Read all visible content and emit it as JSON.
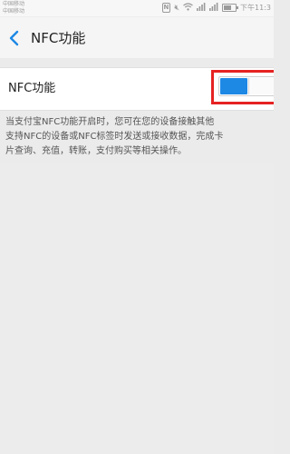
{
  "status_bar": {
    "carrier_1": "中国移动",
    "carrier_2": "中国移动",
    "nfc_indicator": "N",
    "time": "下午11:3",
    "icons": [
      "nfc-icon",
      "mute-icon",
      "wifi-icon",
      "signal-icon",
      "signal-icon",
      "battery-icon"
    ]
  },
  "header": {
    "back_icon": "chevron-left-icon",
    "title": "NFC功能"
  },
  "setting": {
    "label": "NFC功能",
    "toggle_on": true,
    "accent_color": "#1e88e5",
    "highlight_color": "#e62222"
  },
  "description": {
    "line_1": "当支付宝NFC功能开启时，您可在您的设备接触其他",
    "line_2": "支持NFC的设备或NFC标签时发送或接收数据，完成卡",
    "line_3": "片查询、充值，转账，支付购买等相关操作。"
  }
}
